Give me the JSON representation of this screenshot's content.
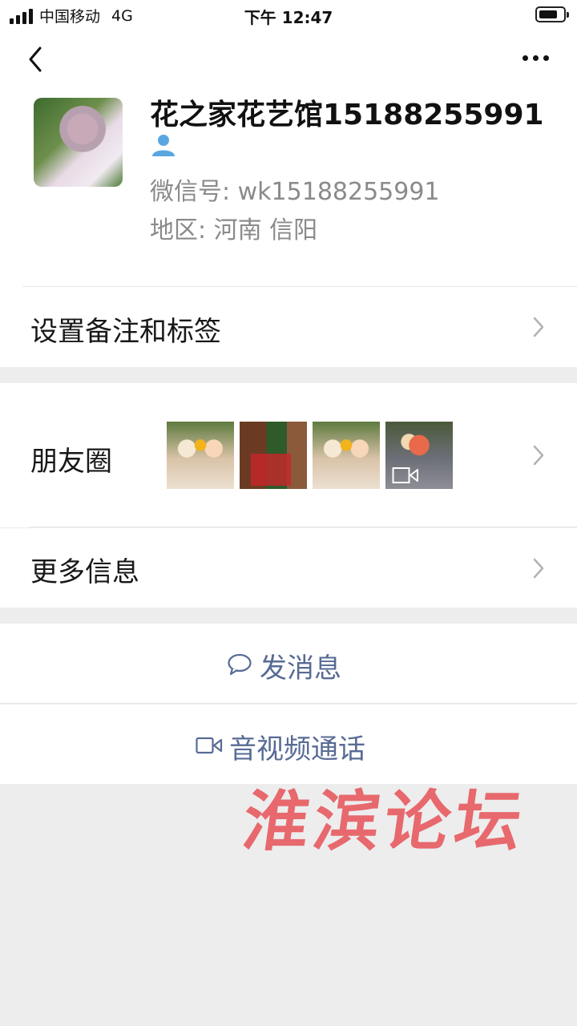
{
  "status_bar": {
    "carrier": "中国移动",
    "network": "4G",
    "time": "下午 12:47"
  },
  "profile": {
    "name": "花之家花艺馆15188255991",
    "wechat_id": "微信号: wk15188255991",
    "region": "地区: 河南 信阳"
  },
  "rows": {
    "remark": "设置备注和标签",
    "moments": "朋友圈",
    "more_info": "更多信息"
  },
  "actions": {
    "message": "发消息",
    "call": "音视频通话"
  },
  "watermark": "淮滨论坛",
  "colors": {
    "link": "#576b95",
    "background": "#ededed",
    "watermark": "#e5373d"
  }
}
